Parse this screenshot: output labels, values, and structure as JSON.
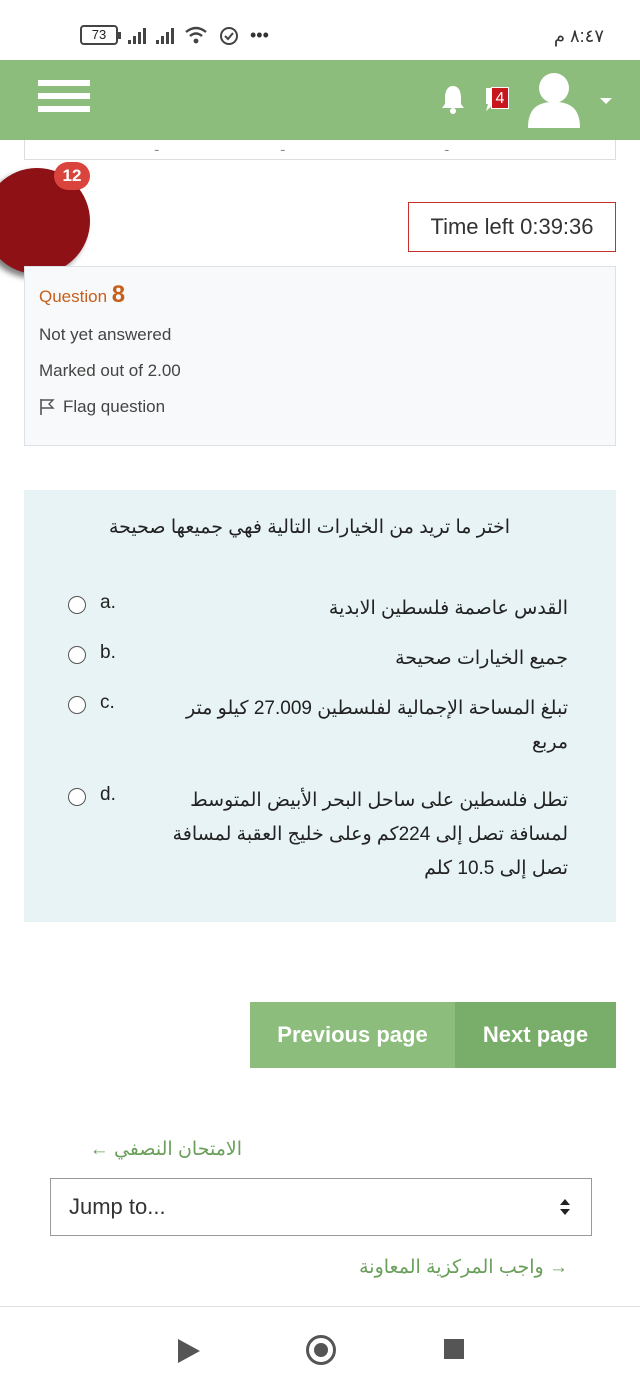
{
  "status_bar": {
    "battery": "73",
    "time": "٨:٤٧ م",
    "more": "•••"
  },
  "header": {
    "message_badge": "4",
    "icons": [
      "menu-icon",
      "bell-icon",
      "message-icon",
      "user-avatar-icon",
      "chevron-down-icon"
    ]
  },
  "notification": {
    "count": "12"
  },
  "timer": {
    "label": "Time left 0:39:36"
  },
  "question_info": {
    "prefix": "Question",
    "number": "8",
    "status": "Not yet answered",
    "marks": "Marked out of 2.00",
    "flag_label": "Flag question"
  },
  "question": {
    "text": "اختر ما تريد من الخيارات التالية فهي جميعها صحيحة",
    "options": [
      {
        "label": "a.",
        "text": "القدس عاصمة فلسطين الابدية"
      },
      {
        "label": "b.",
        "text": "جميع الخيارات صحيحة"
      },
      {
        "label": "c.",
        "text": "تبلغ المساحة الإجمالية لفلسطين 27.009 كيلو متر مربع"
      },
      {
        "label": "d.",
        "text": "تطل فلسطين على ساحل البحر الأبيض المتوسط لمسافة تصل إلى 224كم وعلى خليج العقبة لمسافة تصل إلى 10.5 كلم"
      }
    ]
  },
  "navigation": {
    "previous": "Previous page",
    "next": "Next page"
  },
  "activity_nav": {
    "prev_link": "الامتحان النصفي ←",
    "jump_to": "Jump to...",
    "next_link": "→ واجب المركزية المعاونة"
  }
}
